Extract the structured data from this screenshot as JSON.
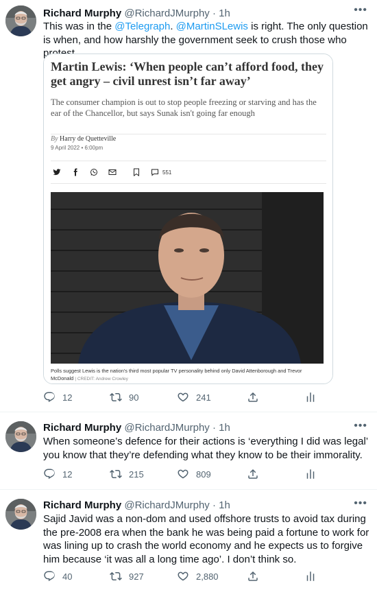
{
  "tweets": [
    {
      "author_name": "Richard Murphy",
      "handle": "@RichardJMurphy",
      "time": "· 1h",
      "text_parts": {
        "a": "This was in the ",
        "m1": "@Telegraph",
        "b": ". ",
        "m2": "@MartinSLewis",
        "c": " is right. The only question is when, and how harshly the government seek to crush those who protest."
      },
      "card": {
        "title": "Martin Lewis: ‘When people can’t afford food, they get angry – civil unrest isn’t far away’",
        "subtitle": "The consumer champion is out to stop people freezing or starving and has the ear of the Chancellor, but says Sunak isn't going far enough",
        "by_prefix": "By",
        "author": "Harry de Quetteville",
        "date": "9 April 2022 • 6:00pm",
        "comment_count": "551",
        "caption": "Polls suggest Lewis is the nation's third most popular TV personality behind only David Attenborough and Trevor McDonald",
        "credit": "| CREDIT: Andrew Crowley"
      },
      "stats": {
        "replies": "12",
        "retweets": "90",
        "likes": "241"
      }
    },
    {
      "author_name": "Richard Murphy",
      "handle": "@RichardJMurphy",
      "time": "· 1h",
      "text": "When someone’s defence for their actions is ‘everything I did was legal’ you know that they’re defending what they know to be their immorality.",
      "stats": {
        "replies": "12",
        "retweets": "215",
        "likes": "809"
      }
    },
    {
      "author_name": "Richard Murphy",
      "handle": "@RichardJMurphy",
      "time": "· 1h",
      "text": "Sajid Javid was a non-dom and used offshore trusts to avoid tax during the pre-2008 era when the bank he was being paid a fortune to work for was lining up to crash the world economy and he expects us to forgive him because ‘it was all a long time ago’. I don’t think so.",
      "stats": {
        "replies": "40",
        "retweets": "927",
        "likes": "2,880"
      }
    }
  ],
  "more_label": "•••",
  "colors": {
    "link": "#1d9bf0",
    "text": "#0f1419",
    "secondary": "#536471",
    "border": "#eff3f4"
  },
  "icons": [
    "reply-icon",
    "retweet-icon",
    "like-icon",
    "share-icon",
    "analytics-icon",
    "more-icon",
    "twitter-icon",
    "facebook-icon",
    "whatsapp-icon",
    "email-icon",
    "bookmark-icon",
    "comment-icon"
  ]
}
